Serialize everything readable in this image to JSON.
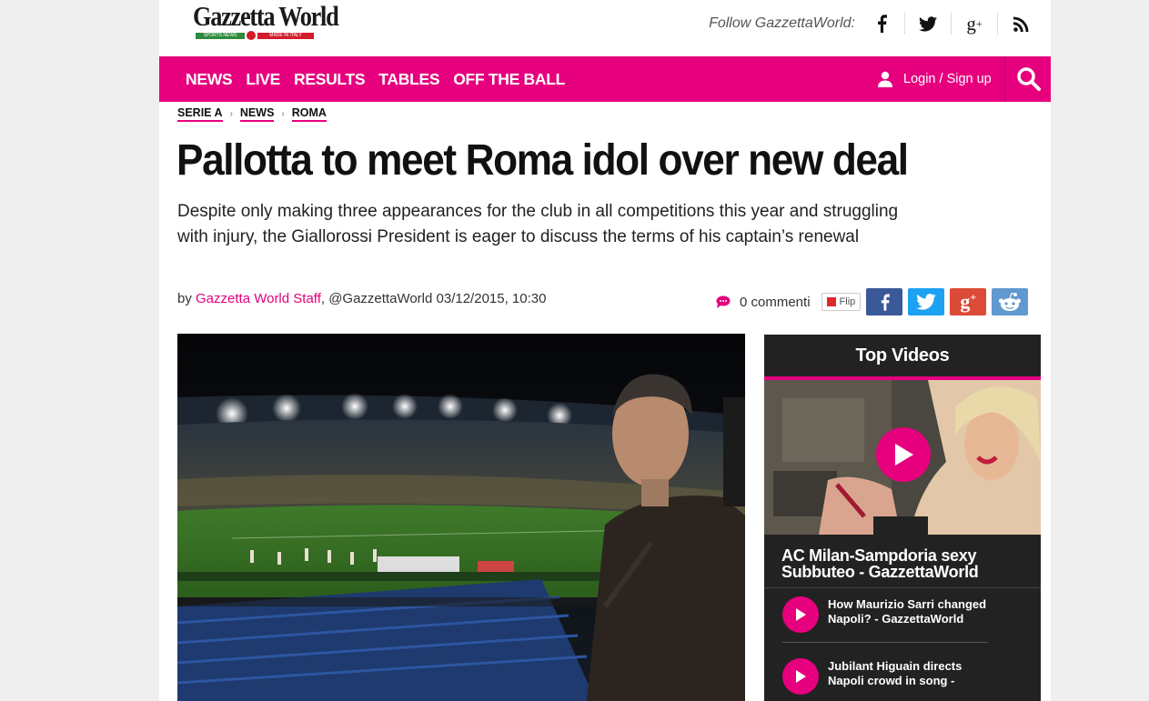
{
  "header": {
    "logo": {
      "name": "Gazzetta World",
      "strip_left": "SPORTS NEWS",
      "strip_right": "MADE IN ITALY"
    },
    "follow_label": "Follow GazzettaWorld:",
    "social": [
      "facebook-icon",
      "twitter-icon",
      "google-plus-icon",
      "rss-icon"
    ]
  },
  "nav": {
    "items": [
      "NEWS",
      "LIVE",
      "RESULTS",
      "TABLES",
      "OFF THE BALL"
    ],
    "login_label": "Login / Sign up"
  },
  "breadcrumb": [
    "SERIE A",
    "NEWS",
    "ROMA"
  ],
  "article": {
    "headline": "Pallotta to meet Roma idol over new deal",
    "standfirst": "Despite only making three appearances for the club in all competitions this year and struggling with injury, the Giallorossi President is eager to discuss the terms of his captain’s renewal",
    "by": "by",
    "author": "Gazzetta World Staff",
    "meta": ", @GazzettaWorld 03/12/2015, 10:30",
    "comments": "0 commenti",
    "flip_label": "Flip",
    "share_buttons": [
      "f",
      "twitter",
      "g+",
      "reddit"
    ]
  },
  "sidebar": {
    "title": "Top Videos",
    "featured_title": "AC Milan-Sampdoria sexy Subbuteo - GazzettaWorld",
    "videos": [
      "How Maurizio Sarri changed Napoli? - GazzettaWorld",
      "Jubilant Higuain directs Napoli crowd in song -"
    ]
  },
  "colors": {
    "brand": "#e6007e",
    "facebook": "#3b5998",
    "twitter": "#1da1f2",
    "google": "#dc4a38",
    "reddit": "#5f99cf"
  }
}
